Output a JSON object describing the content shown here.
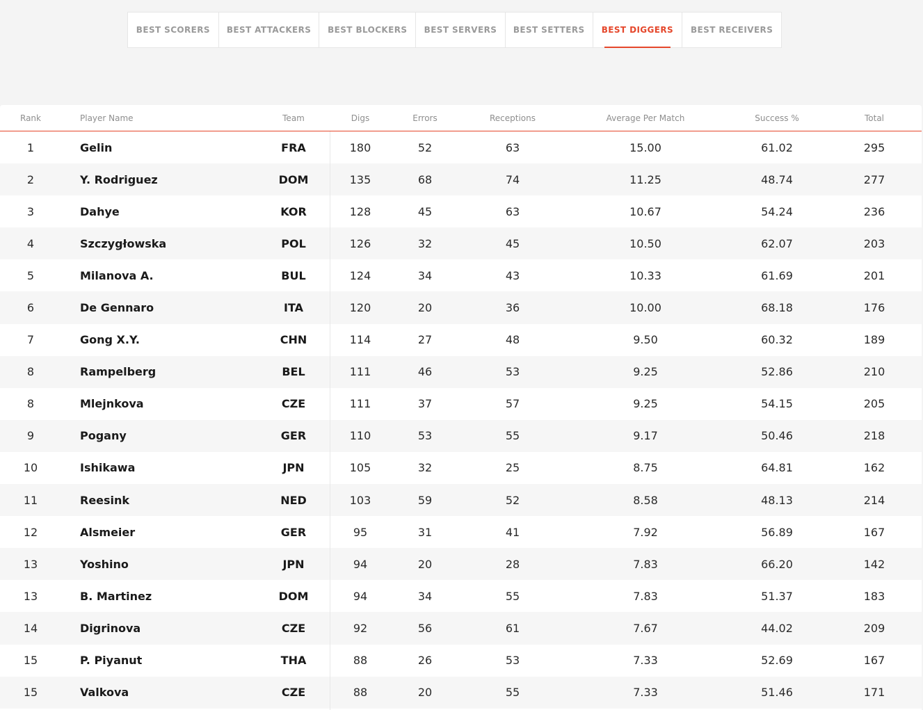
{
  "tabs": [
    {
      "label": "BEST SCORERS",
      "active": false
    },
    {
      "label": "BEST ATTACKERS",
      "active": false
    },
    {
      "label": "BEST BLOCKERS",
      "active": false
    },
    {
      "label": "BEST SERVERS",
      "active": false
    },
    {
      "label": "BEST SETTERS",
      "active": false
    },
    {
      "label": "BEST DIGGERS",
      "active": true
    },
    {
      "label": "BEST RECEIVERS",
      "active": false
    }
  ],
  "accent_color": "#e5472b",
  "table": {
    "headers": {
      "rank": "Rank",
      "name": "Player Name",
      "team": "Team",
      "digs": "Digs",
      "errors": "Errors",
      "receptions": "Receptions",
      "avg": "Average Per Match",
      "success": "Success %",
      "total": "Total"
    },
    "rows": [
      {
        "rank": "1",
        "name": "Gelin",
        "team": "FRA",
        "digs": "180",
        "errors": "52",
        "receptions": "63",
        "avg": "15.00",
        "success": "61.02",
        "total": "295"
      },
      {
        "rank": "2",
        "name": "Y. Rodriguez",
        "team": "DOM",
        "digs": "135",
        "errors": "68",
        "receptions": "74",
        "avg": "11.25",
        "success": "48.74",
        "total": "277"
      },
      {
        "rank": "3",
        "name": "Dahye",
        "team": "KOR",
        "digs": "128",
        "errors": "45",
        "receptions": "63",
        "avg": "10.67",
        "success": "54.24",
        "total": "236"
      },
      {
        "rank": "4",
        "name": "Szczygłowska",
        "team": "POL",
        "digs": "126",
        "errors": "32",
        "receptions": "45",
        "avg": "10.50",
        "success": "62.07",
        "total": "203"
      },
      {
        "rank": "5",
        "name": "Milanova A.",
        "team": "BUL",
        "digs": "124",
        "errors": "34",
        "receptions": "43",
        "avg": "10.33",
        "success": "61.69",
        "total": "201"
      },
      {
        "rank": "6",
        "name": "De Gennaro",
        "team": "ITA",
        "digs": "120",
        "errors": "20",
        "receptions": "36",
        "avg": "10.00",
        "success": "68.18",
        "total": "176"
      },
      {
        "rank": "7",
        "name": "Gong X.Y.",
        "team": "CHN",
        "digs": "114",
        "errors": "27",
        "receptions": "48",
        "avg": "9.50",
        "success": "60.32",
        "total": "189"
      },
      {
        "rank": "8",
        "name": "Rampelberg",
        "team": "BEL",
        "digs": "111",
        "errors": "46",
        "receptions": "53",
        "avg": "9.25",
        "success": "52.86",
        "total": "210"
      },
      {
        "rank": "8",
        "name": "Mlejnkova",
        "team": "CZE",
        "digs": "111",
        "errors": "37",
        "receptions": "57",
        "avg": "9.25",
        "success": "54.15",
        "total": "205"
      },
      {
        "rank": "9",
        "name": "Pogany",
        "team": "GER",
        "digs": "110",
        "errors": "53",
        "receptions": "55",
        "avg": "9.17",
        "success": "50.46",
        "total": "218"
      },
      {
        "rank": "10",
        "name": "Ishikawa",
        "team": "JPN",
        "digs": "105",
        "errors": "32",
        "receptions": "25",
        "avg": "8.75",
        "success": "64.81",
        "total": "162"
      },
      {
        "rank": "11",
        "name": "Reesink",
        "team": "NED",
        "digs": "103",
        "errors": "59",
        "receptions": "52",
        "avg": "8.58",
        "success": "48.13",
        "total": "214"
      },
      {
        "rank": "12",
        "name": "Alsmeier",
        "team": "GER",
        "digs": "95",
        "errors": "31",
        "receptions": "41",
        "avg": "7.92",
        "success": "56.89",
        "total": "167"
      },
      {
        "rank": "13",
        "name": "Yoshino",
        "team": "JPN",
        "digs": "94",
        "errors": "20",
        "receptions": "28",
        "avg": "7.83",
        "success": "66.20",
        "total": "142"
      },
      {
        "rank": "13",
        "name": "B. Martinez",
        "team": "DOM",
        "digs": "94",
        "errors": "34",
        "receptions": "55",
        "avg": "7.83",
        "success": "51.37",
        "total": "183"
      },
      {
        "rank": "14",
        "name": "Digrinova",
        "team": "CZE",
        "digs": "92",
        "errors": "56",
        "receptions": "61",
        "avg": "7.67",
        "success": "44.02",
        "total": "209"
      },
      {
        "rank": "15",
        "name": "P. Piyanut",
        "team": "THA",
        "digs": "88",
        "errors": "26",
        "receptions": "53",
        "avg": "7.33",
        "success": "52.69",
        "total": "167"
      },
      {
        "rank": "15",
        "name": "Valkova",
        "team": "CZE",
        "digs": "88",
        "errors": "20",
        "receptions": "55",
        "avg": "7.33",
        "success": "51.46",
        "total": "171"
      }
    ]
  }
}
